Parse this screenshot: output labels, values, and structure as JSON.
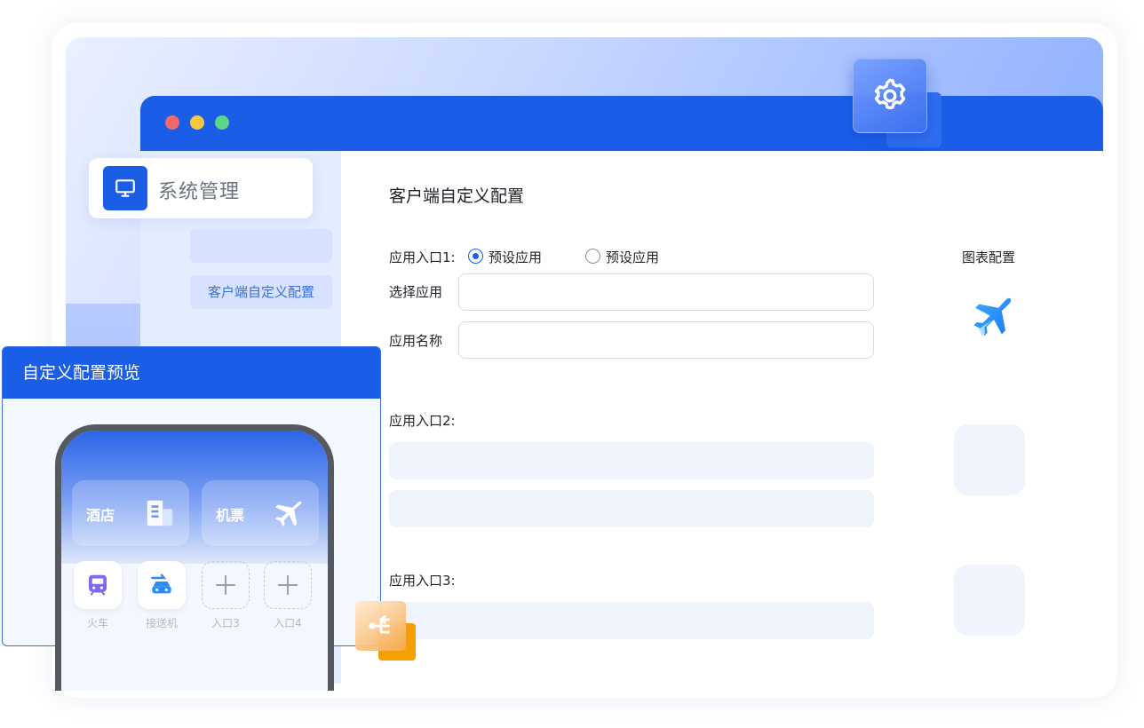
{
  "window": {
    "dots": [
      {
        "name": "close",
        "color": "#f26a6a"
      },
      {
        "name": "minimize",
        "color": "#f5c842"
      },
      {
        "name": "maximize",
        "color": "#5dd68a"
      }
    ]
  },
  "sidebar": {
    "header_label": "系统管理",
    "header_icon": "monitor-icon",
    "items": [
      {
        "label": ""
      },
      {
        "label": "客户端自定义配置"
      }
    ]
  },
  "main": {
    "title": "客户端自定义配置",
    "entry1": {
      "label": "应用入口1:",
      "radio_options": [
        {
          "label": "预设应用",
          "checked": true
        },
        {
          "label": "预设应用",
          "checked": false
        }
      ],
      "select_app_label": "选择应用",
      "select_app_value": "",
      "app_name_label": "应用名称",
      "app_name_value": ""
    },
    "entry2": {
      "label": "应用入口2:"
    },
    "entry3": {
      "label": "应用入口3:"
    },
    "icon_config": {
      "label": "图表配置",
      "icon": "airplane-icon"
    }
  },
  "preview": {
    "title": "自定义配置预览",
    "big_cards": [
      {
        "label": "酒店",
        "icon": "building-icon"
      },
      {
        "label": "机票",
        "icon": "airplane-icon"
      }
    ],
    "small_buttons": [
      {
        "label": "火车",
        "icon": "train-icon"
      },
      {
        "label": "接送机",
        "icon": "car-plane-icon"
      },
      {
        "label": "入口3",
        "icon": "plus-icon"
      },
      {
        "label": "入口4",
        "icon": "plus-icon"
      }
    ]
  },
  "colors": {
    "primary": "#1a5ee8",
    "sidebar_bg": "#e4ecff",
    "accent_orange": "#f5a000"
  }
}
